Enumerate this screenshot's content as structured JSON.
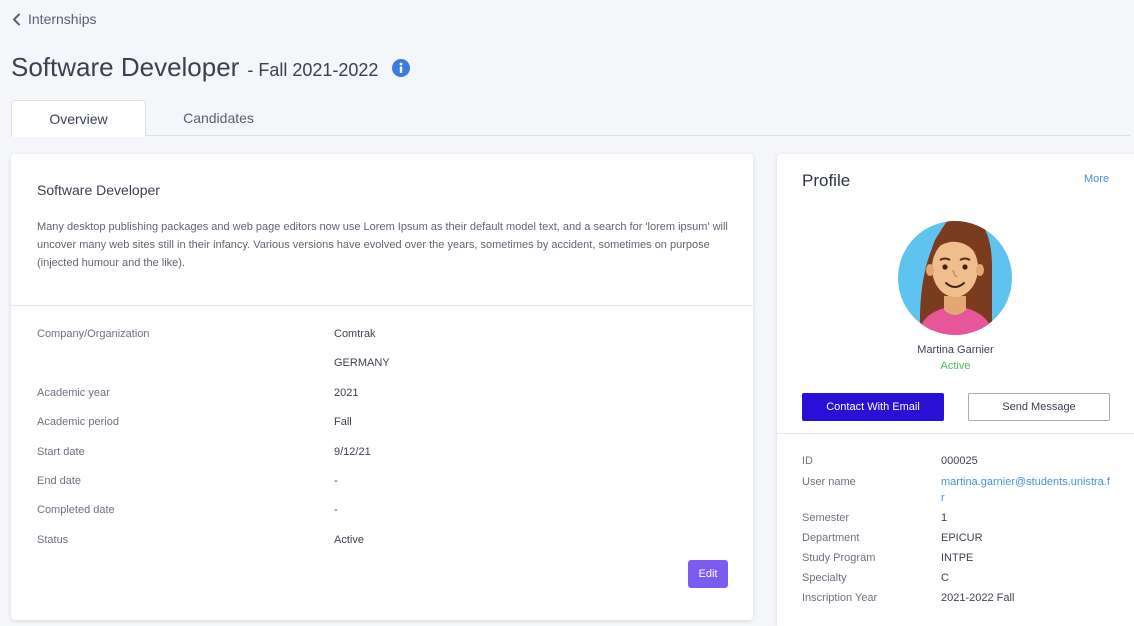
{
  "breadcrumb": {
    "back_label": "Internships"
  },
  "header": {
    "title": "Software Developer",
    "subtitle": "- Fall 2021-2022"
  },
  "tabs": [
    {
      "label": "Overview",
      "active": true
    },
    {
      "label": "Candidates",
      "active": false
    }
  ],
  "job": {
    "title": "Software Developer",
    "description": "Many desktop publishing packages and web page editors now use Lorem Ipsum as their default model text, and a search for 'lorem ipsum' will uncover many web sites still in their infancy. Various versions have evolved over the years, sometimes by accident, sometimes on purpose (injected humour and the like).",
    "details": {
      "company_label": "Company/Organization",
      "company_value": "Comtrak",
      "country_value": "GERMANY",
      "academic_year_label": "Academic year",
      "academic_year_value": "2021",
      "academic_period_label": "Academic period",
      "academic_period_value": "Fall",
      "start_date_label": "Start date",
      "start_date_value": "9/12/21",
      "end_date_label": "End date",
      "end_date_value": "-",
      "completed_date_label": "Completed date",
      "completed_date_value": "-",
      "status_label": "Status",
      "status_value": "Active"
    },
    "edit_label": "Edit"
  },
  "profile": {
    "title": "Profile",
    "more_label": "More",
    "name": "Martina Garnier",
    "status": "Active",
    "contact_label": "Contact With Email",
    "message_label": "Send Message",
    "fields": {
      "id_label": "ID",
      "id_value": "000025",
      "username_label": "User name",
      "username_value": "martina.garnier@students.unistra.fr",
      "semester_label": "Semester",
      "semester_value": "1",
      "department_label": "Department",
      "department_value": "EPICUR",
      "program_label": "Study Program",
      "program_value": "INTPE",
      "specialty_label": "Specialty",
      "specialty_value": "C",
      "inscription_label": "Inscription Year",
      "inscription_value": "2021-2022 Fall"
    }
  },
  "colors": {
    "accent_purple": "#7b5cf0",
    "primary_blue": "#2a0fd6",
    "link_blue": "#4a90d9",
    "status_green": "#5cb85c",
    "info_icon": "#3b7ddd"
  },
  "icons": {
    "back": "chevron-left-icon",
    "info": "info-circle-icon"
  }
}
